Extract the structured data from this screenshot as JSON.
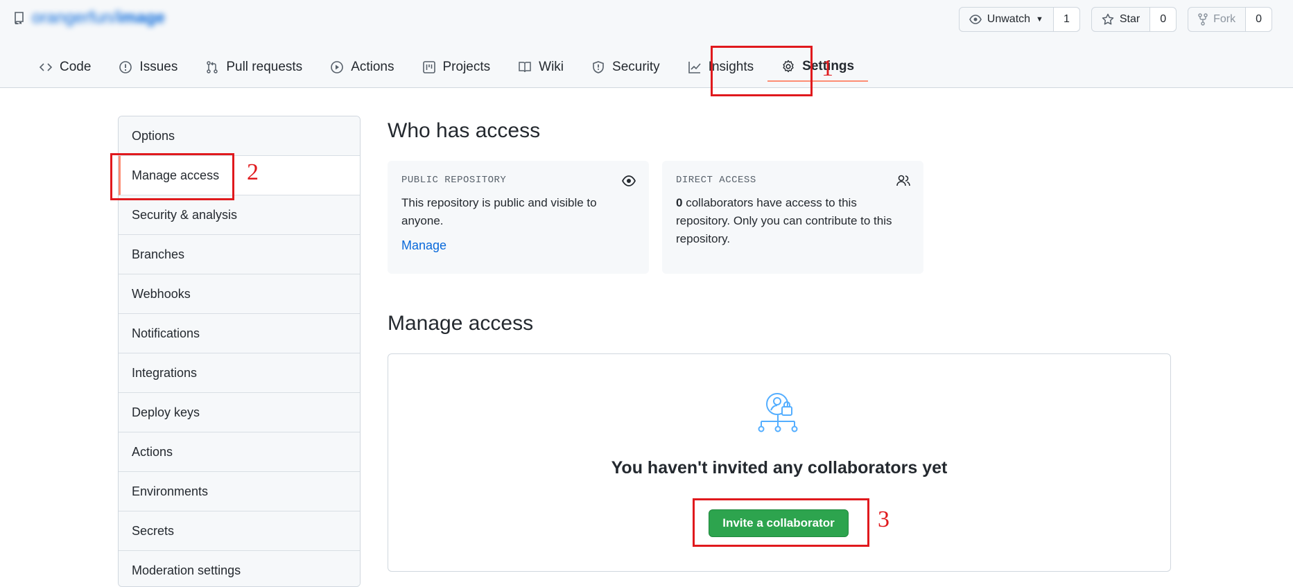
{
  "repo": {
    "owner": "orangerfun",
    "separator": "/",
    "name": "image"
  },
  "header_buttons": {
    "unwatch_label": "Unwatch",
    "unwatch_count": "1",
    "star_label": "Star",
    "star_count": "0",
    "fork_label": "Fork",
    "fork_count": "0"
  },
  "tabs": [
    {
      "label": "Code",
      "icon": "code-icon"
    },
    {
      "label": "Issues",
      "icon": "issue-icon"
    },
    {
      "label": "Pull requests",
      "icon": "pull-request-icon"
    },
    {
      "label": "Actions",
      "icon": "play-icon"
    },
    {
      "label": "Projects",
      "icon": "project-icon"
    },
    {
      "label": "Wiki",
      "icon": "book-icon"
    },
    {
      "label": "Security",
      "icon": "shield-icon"
    },
    {
      "label": "Insights",
      "icon": "graph-icon"
    },
    {
      "label": "Settings",
      "icon": "gear-icon",
      "active": true
    }
  ],
  "annotations": {
    "one": "1",
    "two": "2",
    "three": "3"
  },
  "sidebar": {
    "items": [
      {
        "label": "Options"
      },
      {
        "label": "Manage access",
        "active": true
      },
      {
        "label": "Security & analysis"
      },
      {
        "label": "Branches"
      },
      {
        "label": "Webhooks"
      },
      {
        "label": "Notifications"
      },
      {
        "label": "Integrations"
      },
      {
        "label": "Deploy keys"
      },
      {
        "label": "Actions"
      },
      {
        "label": "Environments"
      },
      {
        "label": "Secrets"
      },
      {
        "label": "Moderation settings"
      }
    ]
  },
  "who_has_access": {
    "title": "Who has access",
    "public_card": {
      "label": "PUBLIC REPOSITORY",
      "text": "This repository is public and visible to anyone.",
      "link": "Manage"
    },
    "direct_card": {
      "label": "DIRECT ACCESS",
      "count": "0",
      "text": " collaborators have access to this repository. Only you can contribute to this repository."
    }
  },
  "manage_access": {
    "title": "Manage access",
    "empty_title": "You haven't invited any collaborators yet",
    "invite_button": "Invite a collaborator"
  },
  "colors": {
    "accent_blue": "#0969da",
    "green_button": "#2da44e",
    "annotation_red": "#e0191d",
    "active_tab_underline": "#fd8c73"
  }
}
